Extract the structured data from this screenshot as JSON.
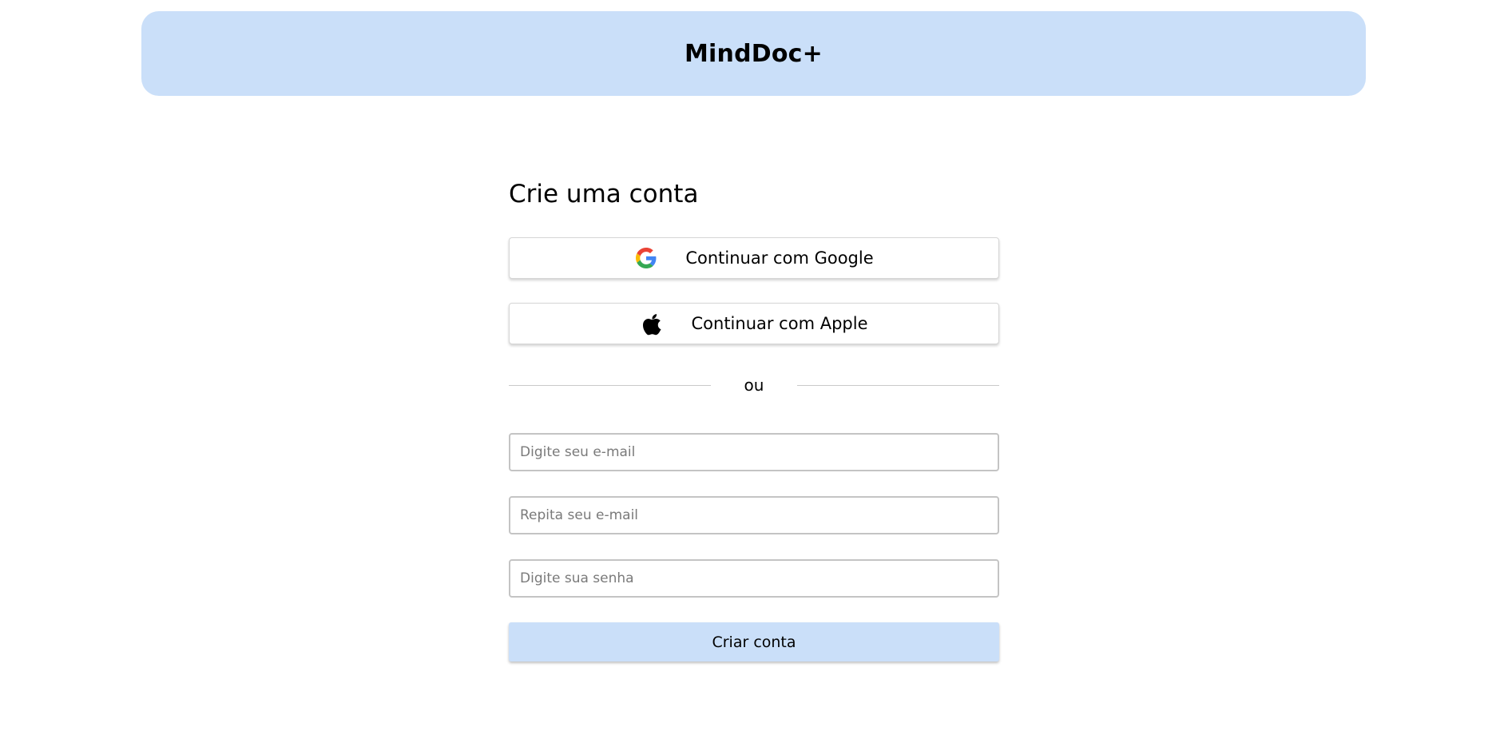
{
  "header": {
    "brand": "MindDoc+"
  },
  "form": {
    "title": "Crie uma conta",
    "google_button": {
      "label": "Continuar com Google",
      "icon": "google-icon"
    },
    "apple_button": {
      "label": "Continuar com Apple",
      "icon": "apple-icon"
    },
    "divider_text": "ou",
    "email_field": {
      "value": "",
      "placeholder": "Digite seu e-mail"
    },
    "repeat_email_field": {
      "value": "",
      "placeholder": "Repita seu e-mail"
    },
    "password_field": {
      "value": "",
      "placeholder": "Digite sua senha"
    },
    "submit_label": "Criar conta"
  },
  "colors": {
    "header_bg": "#cadff9",
    "submit_bg": "#cadff9",
    "google_blue": "#4285F4",
    "google_red": "#EA4335",
    "google_yellow": "#FBBC05",
    "google_green": "#34A853"
  }
}
